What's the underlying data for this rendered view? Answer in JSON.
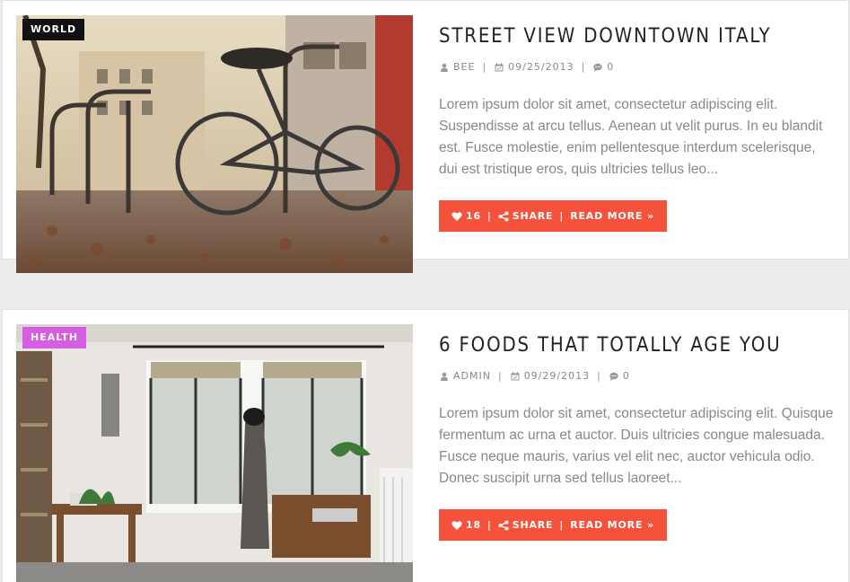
{
  "posts": [
    {
      "category": "WORLD",
      "category_color": "#111111",
      "title": "STREET VIEW DOWNTOWN ITALY",
      "author": "BEE",
      "date": "09/25/2013",
      "comments": "0",
      "excerpt": "Lorem ipsum dolor sit amet, consectetur adipiscing elit. Suspendisse at arcu tellus. Aenean ut velit purus. In eu blandit est. Fusce molestie, enim pellentesque interdum scelerisque, dui est tristique eros, quis ultricies tellus leo...",
      "likes": "16",
      "share_label": "SHARE",
      "read_more_label": "READ MORE",
      "image_icon": "bicycle-photo"
    },
    {
      "category": "HEALTH",
      "category_color": "#d55de2",
      "title": "6 FOODS THAT TOTALLY AGE YOU",
      "author": "ADMIN",
      "date": "09/29/2013",
      "comments": "0",
      "excerpt": "Lorem ipsum dolor sit amet, consectetur adipiscing elit. Quisque fermentum ac urna et auctor. Duis ultricies congue malesuada. Fusce neque mauris, varius vel elit nec, auctor vehicula odio. Donec suscipit urna sed tellus laoreet...",
      "likes": "18",
      "share_label": "SHARE",
      "read_more_label": "READ MORE",
      "image_icon": "room-photo"
    }
  ],
  "colors": {
    "accent": "#f4523b",
    "title": "#222222",
    "meta": "#888888",
    "background": "#ececec"
  }
}
